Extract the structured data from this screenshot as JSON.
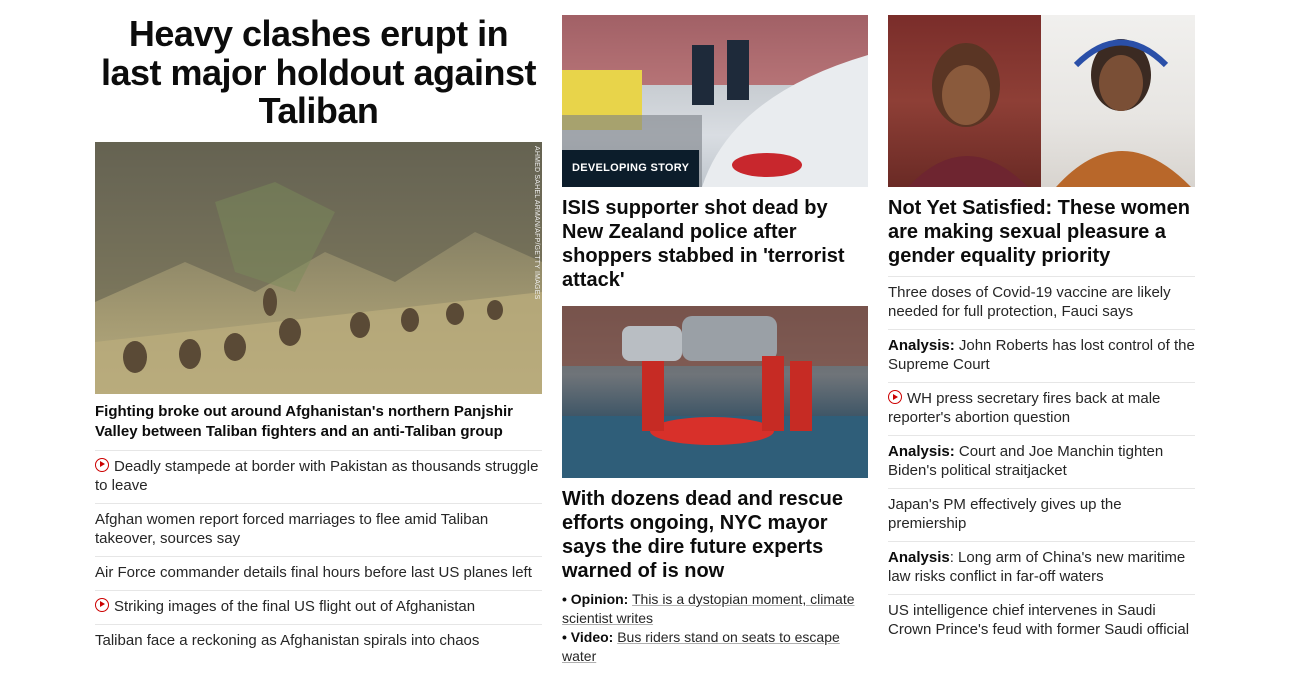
{
  "lead": {
    "headline": "Heavy clashes erupt in last major holdout against Taliban",
    "photo_credit": "AHMED SAHEL ARMAN/AFP/GETTY IMAGES",
    "summary": "Fighting broke out around Afghanistan's northern Panjshir Valley between Taliban fighters and an anti-Taliban group",
    "related": [
      {
        "video": true,
        "text": "Deadly stampede at border with Pakistan as thousands struggle to leave"
      },
      {
        "video": false,
        "text": "Afghan women report forced marriages to flee amid Taliban takeover, sources say"
      },
      {
        "video": false,
        "text": "Air Force commander details final hours before last US planes left"
      },
      {
        "video": true,
        "text": "Striking images of the final US flight out of Afghanistan"
      },
      {
        "video": false,
        "text": "Taliban face a reckoning as Afghanistan spirals into chaos"
      }
    ]
  },
  "nz_story": {
    "badge": "DEVELOPING STORY",
    "headline": "ISIS supporter shot dead by New Zealand police after shoppers stabbed in 'terrorist attack'"
  },
  "nyc_story": {
    "headline": "With dozens dead and rescue efforts ongoing, NYC mayor says the dire future experts warned of is now",
    "links": [
      {
        "prefix": "• Opinion:",
        "text": "This is a dystopian moment, climate scientist writes"
      },
      {
        "prefix": "• Video:",
        "text": "Bus riders stand on seats to escape water"
      }
    ]
  },
  "feature_story": {
    "headline": "Not Yet Satisfied: These women are making sexual pleasure a gender equality priority",
    "headlines": [
      {
        "video": false,
        "prefix": "",
        "text": "Three doses of Covid-19 vaccine are likely needed for full protection, Fauci says"
      },
      {
        "video": false,
        "prefix": "Analysis:",
        "text": " John Roberts has lost control of the Supreme Court"
      },
      {
        "video": true,
        "prefix": "",
        "text": "WH press secretary fires back at male reporter's abortion question"
      },
      {
        "video": false,
        "prefix": "Analysis:",
        "text": " Court and Joe Manchin tighten Biden's political straitjacket"
      },
      {
        "video": false,
        "prefix": "",
        "text": "Japan's PM effectively gives up the premiership"
      },
      {
        "video": false,
        "prefix": "Analysis",
        "text": ": Long arm of China's new maritime law risks conflict in far-off waters"
      },
      {
        "video": false,
        "prefix": "",
        "text": "US intelligence chief intervenes in Saudi Crown Prince's feud with former Saudi official"
      }
    ]
  },
  "colors": {
    "accent": "#cc0000",
    "badge_bg": "#0c1d2b",
    "text": "#0c0c0c",
    "divider": "#e6e6e6"
  }
}
